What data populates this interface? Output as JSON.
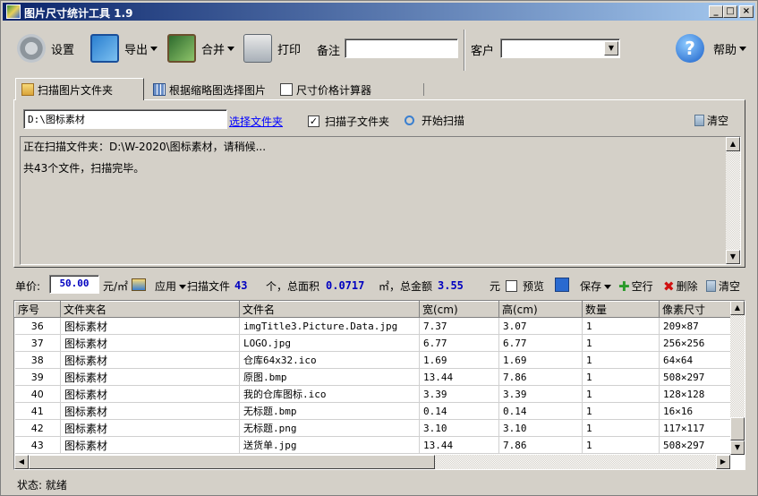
{
  "window": {
    "title": "图片尺寸统计工具 1.9",
    "min": "_",
    "max": "□",
    "close": "×"
  },
  "toolbar": {
    "settings": "设置",
    "export": "导出",
    "merge": "合并",
    "print": "打印",
    "note_label": "备注",
    "note_value": "",
    "customer_label": "客户",
    "customer_value": "",
    "help": "帮助",
    "help_glyph": "?"
  },
  "tabs": [
    {
      "label": "扫描图片文件夹"
    },
    {
      "label": "根据缩略图选择图片"
    },
    {
      "label": "尺寸价格计算器"
    }
  ],
  "scan": {
    "folder_path": "D:\\图标素材",
    "choose_folder": "选择文件夹",
    "include_sub": "扫描子文件夹",
    "include_sub_checked": "✓",
    "start": "开始扫描",
    "clear": "清空",
    "log": [
      "正在扫描文件夹：D:\\W-2020\\图标素材，请稍候...",
      "共43个文件，扫描完毕。"
    ]
  },
  "unitbar": {
    "unit_label": "单价:",
    "unit_price": "50.00",
    "unit_suffix": "元/㎡",
    "apply": "应用",
    "scanned_label": "扫描文件",
    "file_count": "43",
    "area_label": "个，总面积",
    "total_area": "0.0717",
    "amount_label": "㎡，总金额",
    "total_amount": "3.55",
    "currency": "元",
    "preview": "预览",
    "save": "保存",
    "empty_row": "空行",
    "delete": "删除",
    "clear": "清空"
  },
  "grid": {
    "columns": [
      "序号",
      "文件夹名",
      "文件名",
      "宽(cm)",
      "高(cm)",
      "数量",
      "像素尺寸"
    ],
    "rows": [
      [
        "36",
        "图标素材",
        "imgTitle3.Picture.Data.jpg",
        "7.37",
        "3.07",
        "1",
        "209×87"
      ],
      [
        "37",
        "图标素材",
        "LOGO.jpg",
        "6.77",
        "6.77",
        "1",
        "256×256"
      ],
      [
        "38",
        "图标素材",
        "仓库64x32.ico",
        "1.69",
        "1.69",
        "1",
        "64×64"
      ],
      [
        "39",
        "图标素材",
        "原图.bmp",
        "13.44",
        "7.86",
        "1",
        "508×297"
      ],
      [
        "40",
        "图标素材",
        "我的仓库图标.ico",
        "3.39",
        "3.39",
        "1",
        "128×128"
      ],
      [
        "41",
        "图标素材",
        "无标题.bmp",
        "0.14",
        "0.14",
        "1",
        "16×16"
      ],
      [
        "42",
        "图标素材",
        "无标题.png",
        "3.10",
        "3.10",
        "1",
        "117×117"
      ],
      [
        "43",
        "图标素材",
        "送货单.jpg",
        "13.44",
        "7.86",
        "1",
        "508×297"
      ]
    ]
  },
  "status": {
    "text": "状态: 就绪"
  },
  "colors": {
    "titlebar_start": "#0a246a",
    "titlebar_end": "#a6caf0",
    "face": "#d4d0c8",
    "value_blue": "#0000c0"
  }
}
